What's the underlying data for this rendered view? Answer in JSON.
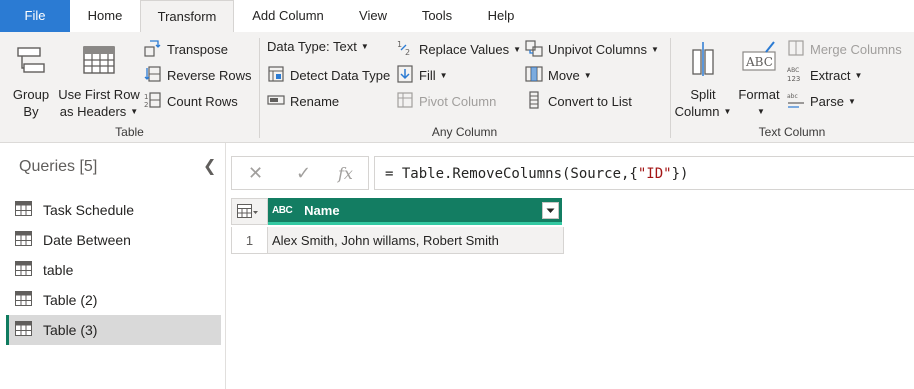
{
  "tabs": [
    {
      "label": "File"
    },
    {
      "label": "Home"
    },
    {
      "label": "Transform"
    },
    {
      "label": "Add Column"
    },
    {
      "label": "View"
    },
    {
      "label": "Tools"
    },
    {
      "label": "Help"
    }
  ],
  "ribbon": {
    "table_group": {
      "label": "Table",
      "group_by": {
        "line1": "Group",
        "line2": "By"
      },
      "use_first_row": {
        "line1": "Use First Row",
        "line2": "as Headers"
      },
      "transpose": "Transpose",
      "reverse_rows": "Reverse Rows",
      "count_rows": "Count Rows"
    },
    "any_column_group": {
      "label": "Any Column",
      "data_type": "Data Type: Text",
      "detect_data_type": "Detect Data Type",
      "rename": "Rename",
      "replace_values": "Replace Values",
      "fill": "Fill",
      "pivot_column": "Pivot Column",
      "unpivot_columns": "Unpivot Columns",
      "move": "Move",
      "convert_to_list": "Convert to List"
    },
    "text_column_group": {
      "label": "Text Column",
      "split_column": {
        "line1": "Split",
        "line2": "Column"
      },
      "format": "Format",
      "merge_columns": "Merge Columns",
      "extract": "Extract",
      "parse": "Parse"
    }
  },
  "queries": {
    "title": "Queries [5]",
    "items": [
      {
        "label": "Task Schedule"
      },
      {
        "label": "Date Between"
      },
      {
        "label": "table"
      },
      {
        "label": "Table (2)"
      },
      {
        "label": "Table (3)",
        "selected": true
      }
    ]
  },
  "formula_bar": {
    "cancel_glyph": "✕",
    "commit_glyph": "✓",
    "fx_glyph": "fx",
    "prefix": "= Table.RemoveColumns(Source,{",
    "string_arg": "\"ID\"",
    "suffix": "})"
  },
  "grid": {
    "column": {
      "type_icon": "ABC",
      "name": "Name"
    },
    "rows": [
      {
        "index": "1",
        "name": "Alex Smith, John willams, Robert Smith"
      }
    ]
  },
  "colors": {
    "file_tab": "#2b7bd3",
    "column_header": "#137d62",
    "column_header_underline": "#33c9a2",
    "selected_query_marker": "#0f7b5f"
  }
}
